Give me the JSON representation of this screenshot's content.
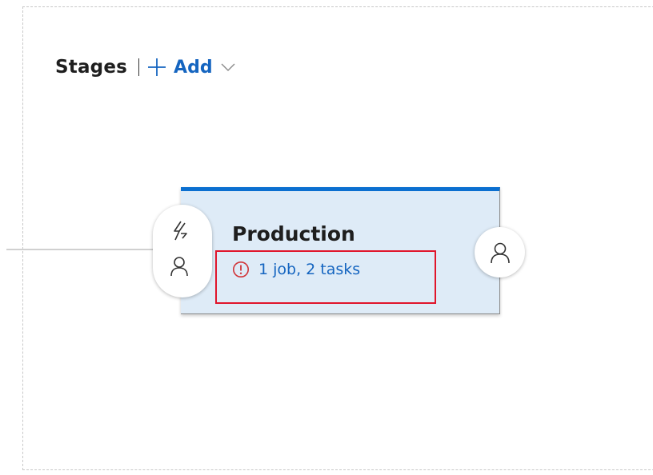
{
  "header": {
    "title": "Stages",
    "add_label": "Add"
  },
  "stage": {
    "name": "Production",
    "summary": "1 job, 2 tasks",
    "status": "error"
  },
  "icons": {
    "add": "plus-icon",
    "add_menu": "chevron-down-icon",
    "summary_status": "error-circle-icon",
    "pre_trigger": "lightning-icon",
    "pre_approver": "person-icon",
    "post_approver": "person-icon"
  },
  "colors": {
    "accent": "#1565c0",
    "stage_bar": "#0b6fd0",
    "stage_fill": "#deebf7",
    "error": "#d13438",
    "highlight": "#e0152b"
  }
}
